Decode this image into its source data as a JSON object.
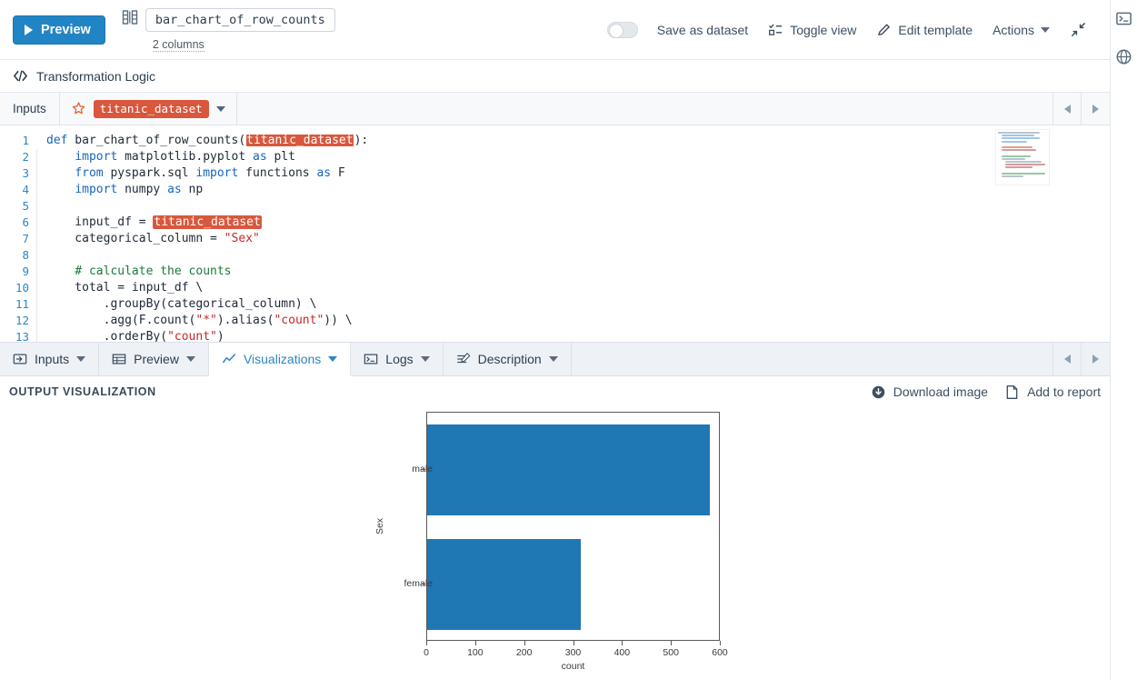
{
  "topbar": {
    "preview_label": "Preview",
    "transform_name": "bar_chart_of_row_counts",
    "columns_label": "2 columns",
    "save_as_dataset_label": "Save as dataset",
    "toggle_view_label": "Toggle view",
    "edit_template_label": "Edit template",
    "actions_label": "Actions"
  },
  "transformation_logic": {
    "title": "Transformation Logic"
  },
  "inputs": {
    "label": "Inputs",
    "dataset_chip": "titanic_dataset"
  },
  "editor": {
    "line_numbers": [
      "1",
      "2",
      "3",
      "4",
      "5",
      "6",
      "7",
      "8",
      "9",
      "10",
      "11",
      "12",
      "13"
    ],
    "lines": [
      "def bar_chart_of_row_counts(titanic_dataset):",
      "    import matplotlib.pyplot as plt",
      "    from pyspark.sql import functions as F",
      "    import numpy as np",
      "",
      "    input_df = titanic_dataset",
      "    categorical_column = \"Sex\"",
      "",
      "    # calculate the counts",
      "    total = input_df \\",
      "        .groupBy(categorical_column) \\",
      "        .agg(F.count(\"*\").alias(\"count\")) \\",
      "        .orderBy(\"count\")"
    ]
  },
  "tabs": [
    {
      "label": "Inputs",
      "icon": "inputs-icon",
      "active": false
    },
    {
      "label": "Preview",
      "icon": "table-icon",
      "active": false
    },
    {
      "label": "Visualizations",
      "icon": "line-chart-icon",
      "active": true
    },
    {
      "label": "Logs",
      "icon": "terminal-icon",
      "active": false
    },
    {
      "label": "Description",
      "icon": "description-icon",
      "active": false
    }
  ],
  "output": {
    "title": "OUTPUT VISUALIZATION",
    "download_image_label": "Download image",
    "add_to_report_label": "Add to report"
  },
  "chart_data": {
    "type": "bar",
    "orientation": "horizontal",
    "title": "",
    "xlabel": "count",
    "ylabel": "Sex",
    "categories": [
      "female",
      "male"
    ],
    "values": [
      314,
      577
    ],
    "xlim": [
      0,
      600
    ],
    "xticks": [
      0,
      100,
      200,
      300,
      400,
      500,
      600
    ],
    "bar_color": "#1f77b4",
    "grid": false,
    "legend": false
  },
  "rail": {
    "terminal_label": "terminal-icon",
    "globe_label": "globe-icon"
  }
}
